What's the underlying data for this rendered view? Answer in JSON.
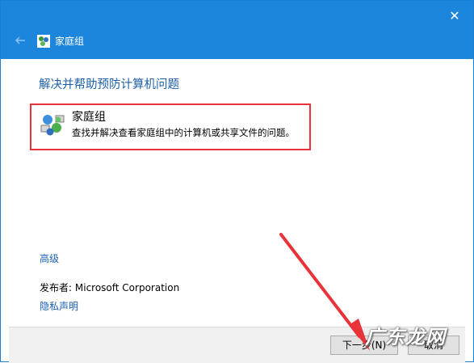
{
  "window": {
    "title": "家庭组",
    "close_glyph": "✕",
    "titlebar_color": "#1c86dd"
  },
  "main": {
    "heading": "解决并帮助预防计算机问题",
    "item": {
      "title": "家庭组",
      "description": "查找并解决查看家庭组中的计算机或共享文件的问题。",
      "icon": "homegroup-icon",
      "highlight_color": "#e8333b"
    },
    "advanced_label": "高级",
    "publisher_label": "发布者:",
    "publisher_value": "Microsoft Corporation",
    "privacy_label": "隐私声明"
  },
  "footer": {
    "next_label": "下一步(N)",
    "cancel_label": "取消"
  },
  "watermark": {
    "text": "广东龙网"
  },
  "colors": {
    "link": "#1a5fb4",
    "annotation_arrow": "#e8333b"
  }
}
